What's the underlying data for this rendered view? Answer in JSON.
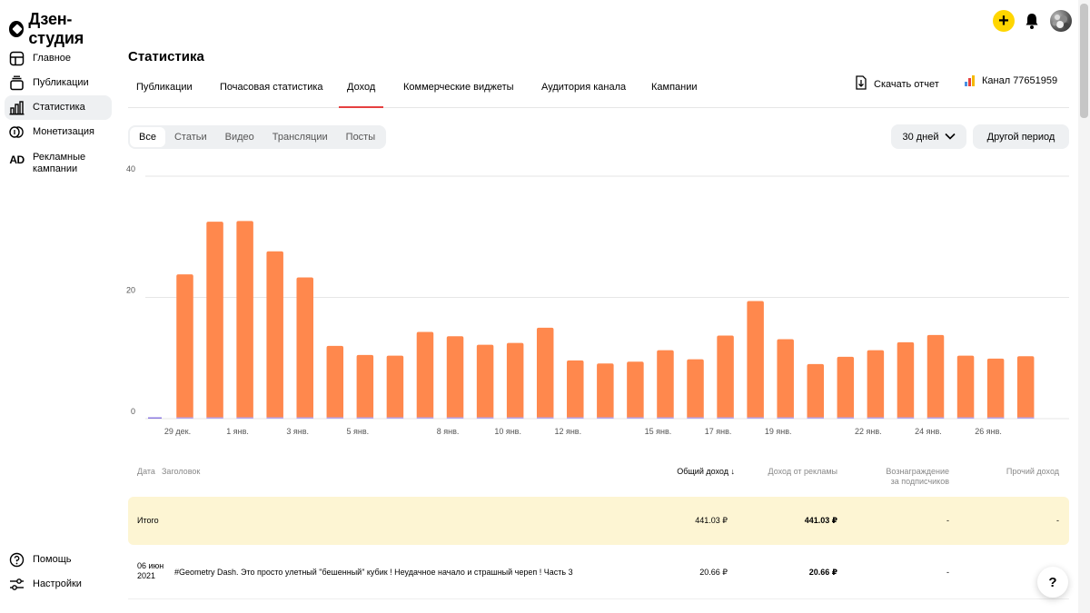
{
  "app": {
    "name": "Дзен-студия"
  },
  "sidebar": {
    "items": [
      {
        "label": "Главное",
        "icon": "layout-icon"
      },
      {
        "label": "Публикации",
        "icon": "publications-icon"
      },
      {
        "label": "Статистика",
        "icon": "stats-icon",
        "active": true
      },
      {
        "label": "Монетизация",
        "icon": "coins-icon"
      },
      {
        "label": "Рекламные кампании",
        "icon": "ad-icon",
        "icon_text": "AD"
      }
    ],
    "bottom": [
      {
        "label": "Помощь",
        "icon": "help-icon"
      },
      {
        "label": "Настройки",
        "icon": "settings-icon"
      }
    ]
  },
  "header": {
    "plus": "+"
  },
  "main": {
    "title": "Статистика",
    "tabs": [
      {
        "label": "Публикации"
      },
      {
        "label": "Почасовая статистика"
      },
      {
        "label": "Доход",
        "active": true
      },
      {
        "label": "Коммерческие виджеты"
      },
      {
        "label": "Аудитория канала"
      },
      {
        "label": "Кампании"
      }
    ],
    "download_label": "Скачать отчет",
    "channel_label": "Канал 77651959",
    "filters": [
      "Все",
      "Статьи",
      "Видео",
      "Трансляции",
      "Посты"
    ],
    "active_filter": "Все",
    "period_label": "30 дней",
    "other_period_label": "Другой период"
  },
  "chart_data": {
    "type": "bar",
    "ylim": [
      0,
      40
    ],
    "yticks": [
      0,
      20,
      40
    ],
    "xticks": [
      "29 дек.",
      "1 янв.",
      "3 янв.",
      "5 янв.",
      "8 янв.",
      "10 янв.",
      "12 янв.",
      "15 янв.",
      "17 янв.",
      "19 янв.",
      "22 янв.",
      "24 янв.",
      "26 янв."
    ],
    "series": [
      {
        "color": "#ff884d",
        "values": [
          23.8,
          32.5,
          32.6,
          27.6,
          23.3,
          12.0,
          10.5,
          10.4,
          14.3,
          13.6,
          12.2,
          12.5,
          15.0,
          9.6,
          9.1,
          9.4,
          11.3,
          9.8,
          13.7,
          19.4,
          13.1,
          9.0,
          10.2,
          11.3,
          12.6,
          13.8,
          10.4,
          9.9,
          10.3
        ]
      }
    ]
  },
  "table": {
    "headers": {
      "date": "Дата",
      "title": "Заголовок",
      "total": "Общий доход",
      "sort_arrow": "↓",
      "ads": "Доход от рекламы",
      "subs_line1": "Вознаграждение",
      "subs_line2": "за подписчиков",
      "other": "Прочий доход"
    },
    "total_row": {
      "label": "Итого",
      "total": "441.03 ₽",
      "ads": "441.03 ₽",
      "subs": "-",
      "other": "-"
    },
    "rows": [
      {
        "date_line1": "06 июн",
        "date_line2": "2021",
        "title": "#Geometry Dash. Это просто улетный \"бешенный\" кубик ! Неудачное начало и страшный череп ! Часть 3",
        "total": "20.66 ₽",
        "ads": "20.66 ₽",
        "subs": "-"
      }
    ]
  },
  "help_fab": "?"
}
